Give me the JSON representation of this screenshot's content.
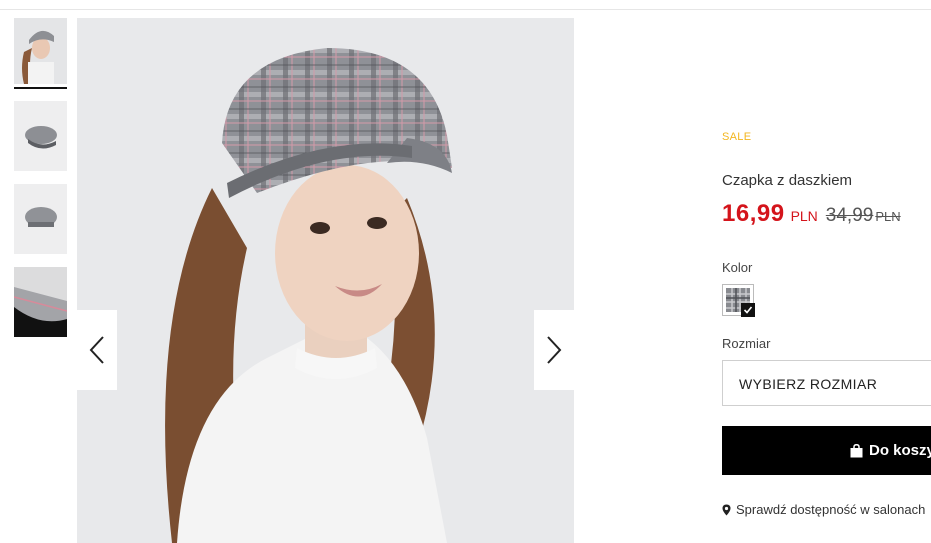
{
  "product": {
    "badge": "SALE",
    "name": "Czapka z daszkiem",
    "price_new": "16,99",
    "price_new_currency": "PLN",
    "price_old": "34,99",
    "price_old_currency": "PLN"
  },
  "options": {
    "color_label": "Kolor",
    "size_label": "Rozmiar",
    "size_select_value": "WYBIERZ ROZMIAR"
  },
  "actions": {
    "add_to_cart_label": "Do koszy",
    "check_store_label": "Sprawdź dostępność w salonach"
  },
  "gallery": {
    "thumbnail_count": 4,
    "active_index": 0
  },
  "colors": {
    "sale_badge": "#f3b61f",
    "price_red": "#d4141b",
    "cart_button_bg": "#000000"
  }
}
